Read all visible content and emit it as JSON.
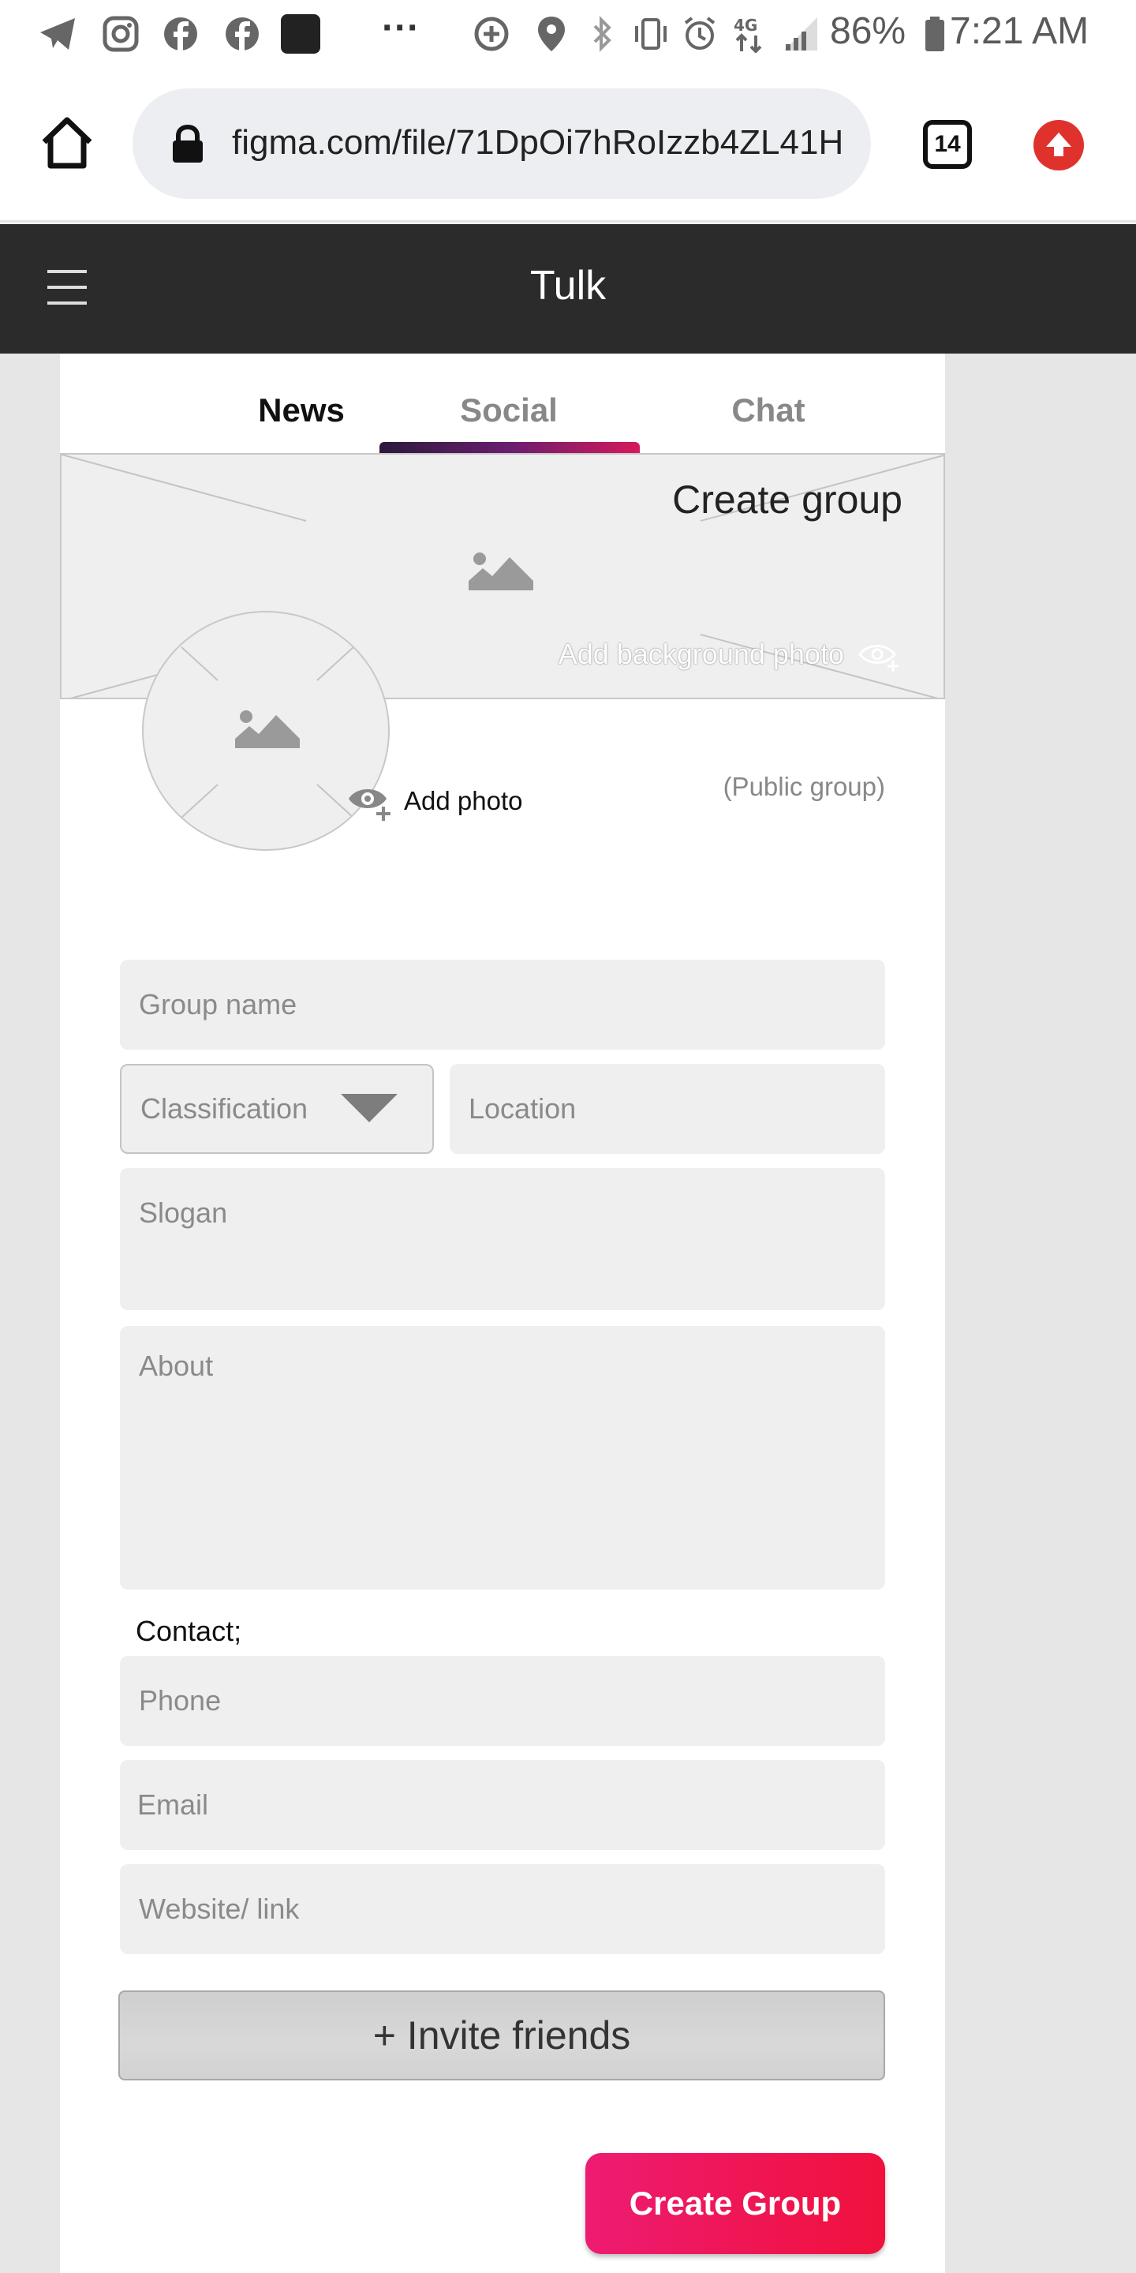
{
  "status_bar": {
    "battery": "86%",
    "time": "7:21 AM",
    "network": "4G",
    "more": "···"
  },
  "browser": {
    "url": "figma.com/file/71DpOi7hRoIzzb4ZL41H",
    "tab_count": "14"
  },
  "app": {
    "title": "Tulk"
  },
  "tabs": [
    {
      "label": "News",
      "active": false
    },
    {
      "label": "Social",
      "active": true
    },
    {
      "label": "Chat",
      "active": false
    }
  ],
  "cover": {
    "title": "Create group",
    "add_background": "Add background photo"
  },
  "profile": {
    "add_photo": "Add photo",
    "visibility": "(Public group)"
  },
  "form": {
    "group_name": "Group name",
    "classification": "Classification",
    "location": "Location",
    "slogan": "Slogan",
    "about": "About",
    "contact_label": "Contact;",
    "phone": "Phone",
    "email": "Email",
    "website": "Website/ link"
  },
  "actions": {
    "invite": "+ Invite friends",
    "create": "Create Group"
  },
  "colors": {
    "header_bg": "#2b2b2b",
    "accent": "#ee1b72",
    "update": "#e0322d"
  }
}
